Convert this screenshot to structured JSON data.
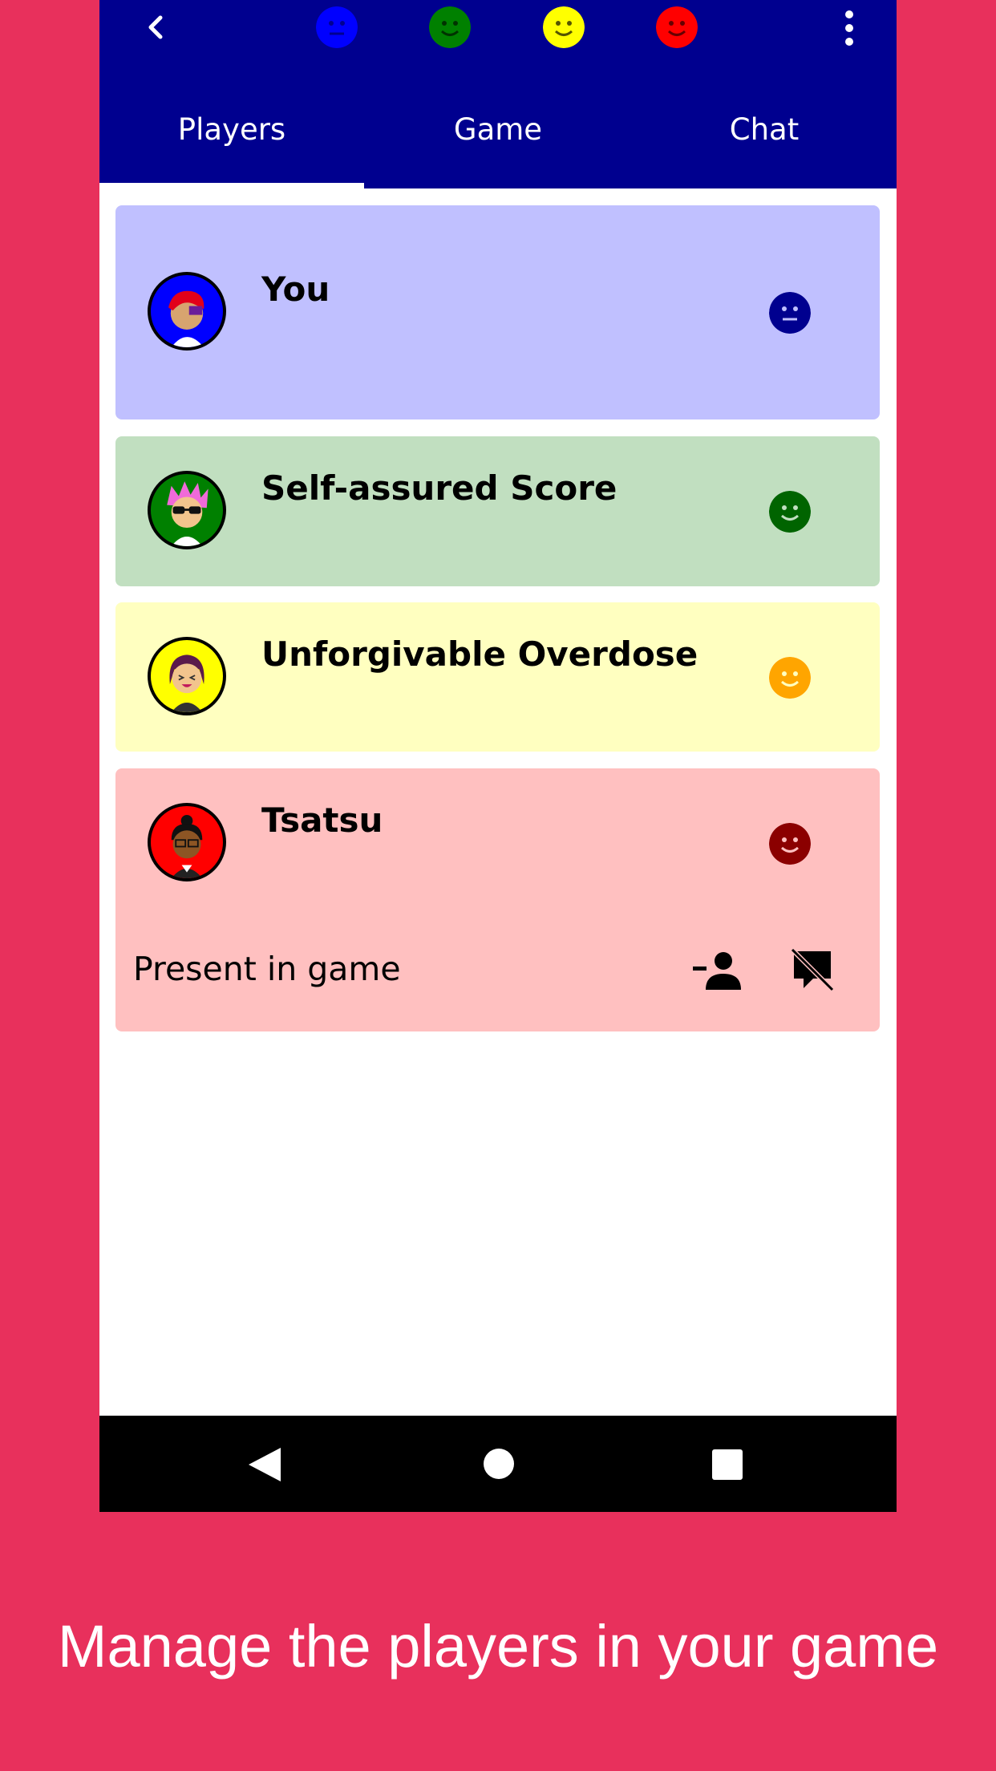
{
  "tabs": [
    {
      "label": "Players",
      "selected": true
    },
    {
      "label": "Game",
      "selected": false
    },
    {
      "label": "Chat",
      "selected": false
    }
  ],
  "top_faces": [
    {
      "icon": "neutral-face-icon",
      "color": "#0000ff"
    },
    {
      "icon": "smile-face-icon",
      "color": "#008000"
    },
    {
      "icon": "smile-face-icon",
      "color": "#ffff00"
    },
    {
      "icon": "smile-face-icon",
      "color": "#ff0000"
    }
  ],
  "players": [
    {
      "name": "You",
      "card_color": "#c0c0ff",
      "avatar_ring": "#0000ff",
      "status_icon": "neutral-face-icon",
      "status_color": "#00008f"
    },
    {
      "name": "Self-assured Score",
      "card_color": "#c1dfc0",
      "avatar_ring": "#008000",
      "status_icon": "smile-face-icon",
      "status_color": "#006400"
    },
    {
      "name": "Unforgivable Overdose",
      "card_color": "#ffffc0",
      "avatar_ring": "#ffff00",
      "status_icon": "smile-face-icon",
      "status_color": "#ffa500"
    },
    {
      "name": "Tsatsu",
      "card_color": "#ffc0c0",
      "avatar_ring": "#ff0000",
      "status_icon": "smile-face-icon",
      "status_color": "#8b0000"
    }
  ],
  "expanded_player": {
    "status_text": "Present in game",
    "actions": [
      "remove-person-icon",
      "mute-chat-icon"
    ]
  },
  "caption": "Manage the players in your game"
}
